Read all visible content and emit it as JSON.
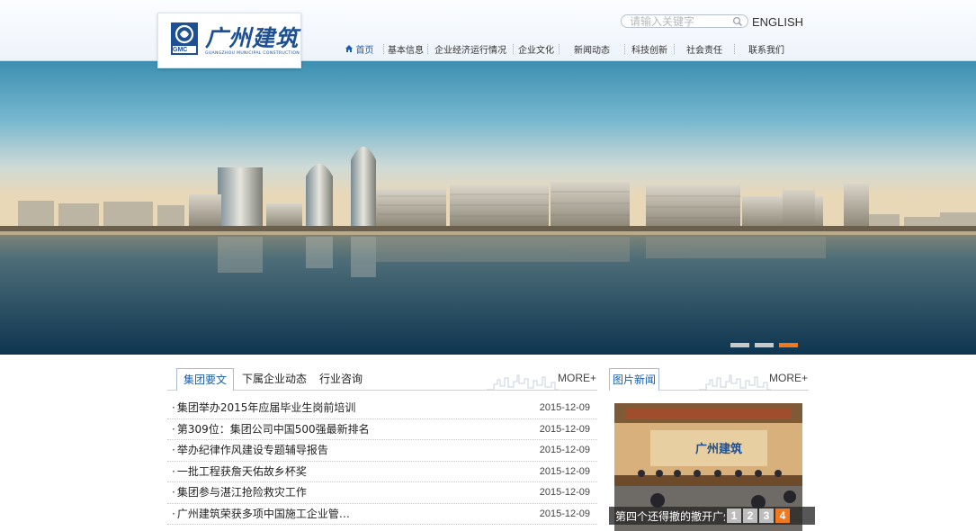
{
  "header": {
    "logo_text": "广州建筑",
    "logo_badge": "GMC",
    "logo_subtitle": "GUANGZHOU MUNICIPAL CONSTRUCTION",
    "search_placeholder": "请输入关键字",
    "language_link": "ENGLISH"
  },
  "nav": {
    "items": [
      "首页",
      "基本信息",
      "企业经济运行情况",
      "企业文化",
      "新闻动态",
      "科技创新",
      "社会责任",
      "联系我们"
    ],
    "active_index": 0
  },
  "banner": {
    "slide_count": 3,
    "active_slide": 3
  },
  "news": {
    "tabs": [
      "集团要文",
      "下属企业动态",
      "行业咨询"
    ],
    "active_tab": 0,
    "more_label": "MORE+",
    "items": [
      {
        "title": "集团举办2015年应届毕业生岗前培训",
        "date": "2015-12-09"
      },
      {
        "title": "第309位：集团公司中国500强最新排名",
        "date": "2015-12-09"
      },
      {
        "title": "举办纪律作风建设专题辅导报告",
        "date": "2015-12-09"
      },
      {
        "title": "一批工程获詹天佑故乡杯奖",
        "date": "2015-12-09"
      },
      {
        "title": "集团参与湛江抢险救灾工作",
        "date": "2015-12-09"
      },
      {
        "title": "广州建筑荣获多项中国施工企业管…",
        "date": "2015-12-09"
      }
    ]
  },
  "pic_news": {
    "title": "图片新闻",
    "more_label": "MORE+",
    "caption": "第四个还得撤的撤开广州建筑",
    "pager": [
      "1",
      "2",
      "3",
      "4"
    ],
    "active_page": 4,
    "photo_banner_text": "广州建筑"
  },
  "colors": {
    "brand_blue": "#1d4f93",
    "nav_active": "#1a5fb4",
    "accent_orange": "#f0781e",
    "tab_blue": "#1d5fa8"
  }
}
